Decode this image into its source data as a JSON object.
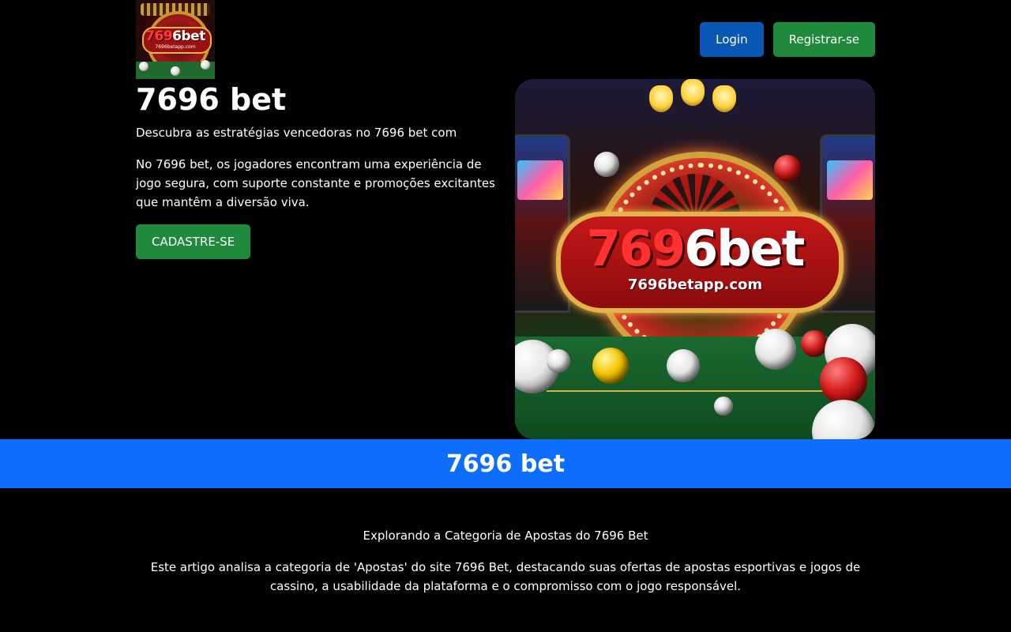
{
  "header": {
    "logo": {
      "brand_prefix": "769",
      "brand_suffix": "6bet",
      "url_text": "7696betapp.com",
      "icon": "brand-logo"
    },
    "login_label": "Login",
    "register_label": "Registrar-se"
  },
  "hero": {
    "title": "7696 bet",
    "subtitle": "Descubra as estratégias vencedoras no 7696 bet com",
    "text": "No 7696 bet, os jogadores encontram uma experiência de jogo segura, com suporte constante e promoções excitantes que mantêm a diversão viva.",
    "cta_label": "CADASTRE-SE",
    "image": {
      "brand_prefix": "769",
      "brand_suffix": "6bet",
      "url_text": "7696betapp.com"
    }
  },
  "banner": {
    "title": "7696 bet"
  },
  "article": {
    "heading": "Explorando a Categoria de Apostas do 7696 Bet",
    "text": "Este artigo analisa a categoria de 'Apostas' do site 7696 Bet, destacando suas ofertas de apostas esportivas e jogos de cassino, a usabilidade da plataforma e o compromisso com o jogo responsável."
  },
  "colors": {
    "background": "#000000",
    "login_button": "#0a57b5",
    "register_button": "#1f8a3b",
    "banner": "#0d6efd"
  }
}
